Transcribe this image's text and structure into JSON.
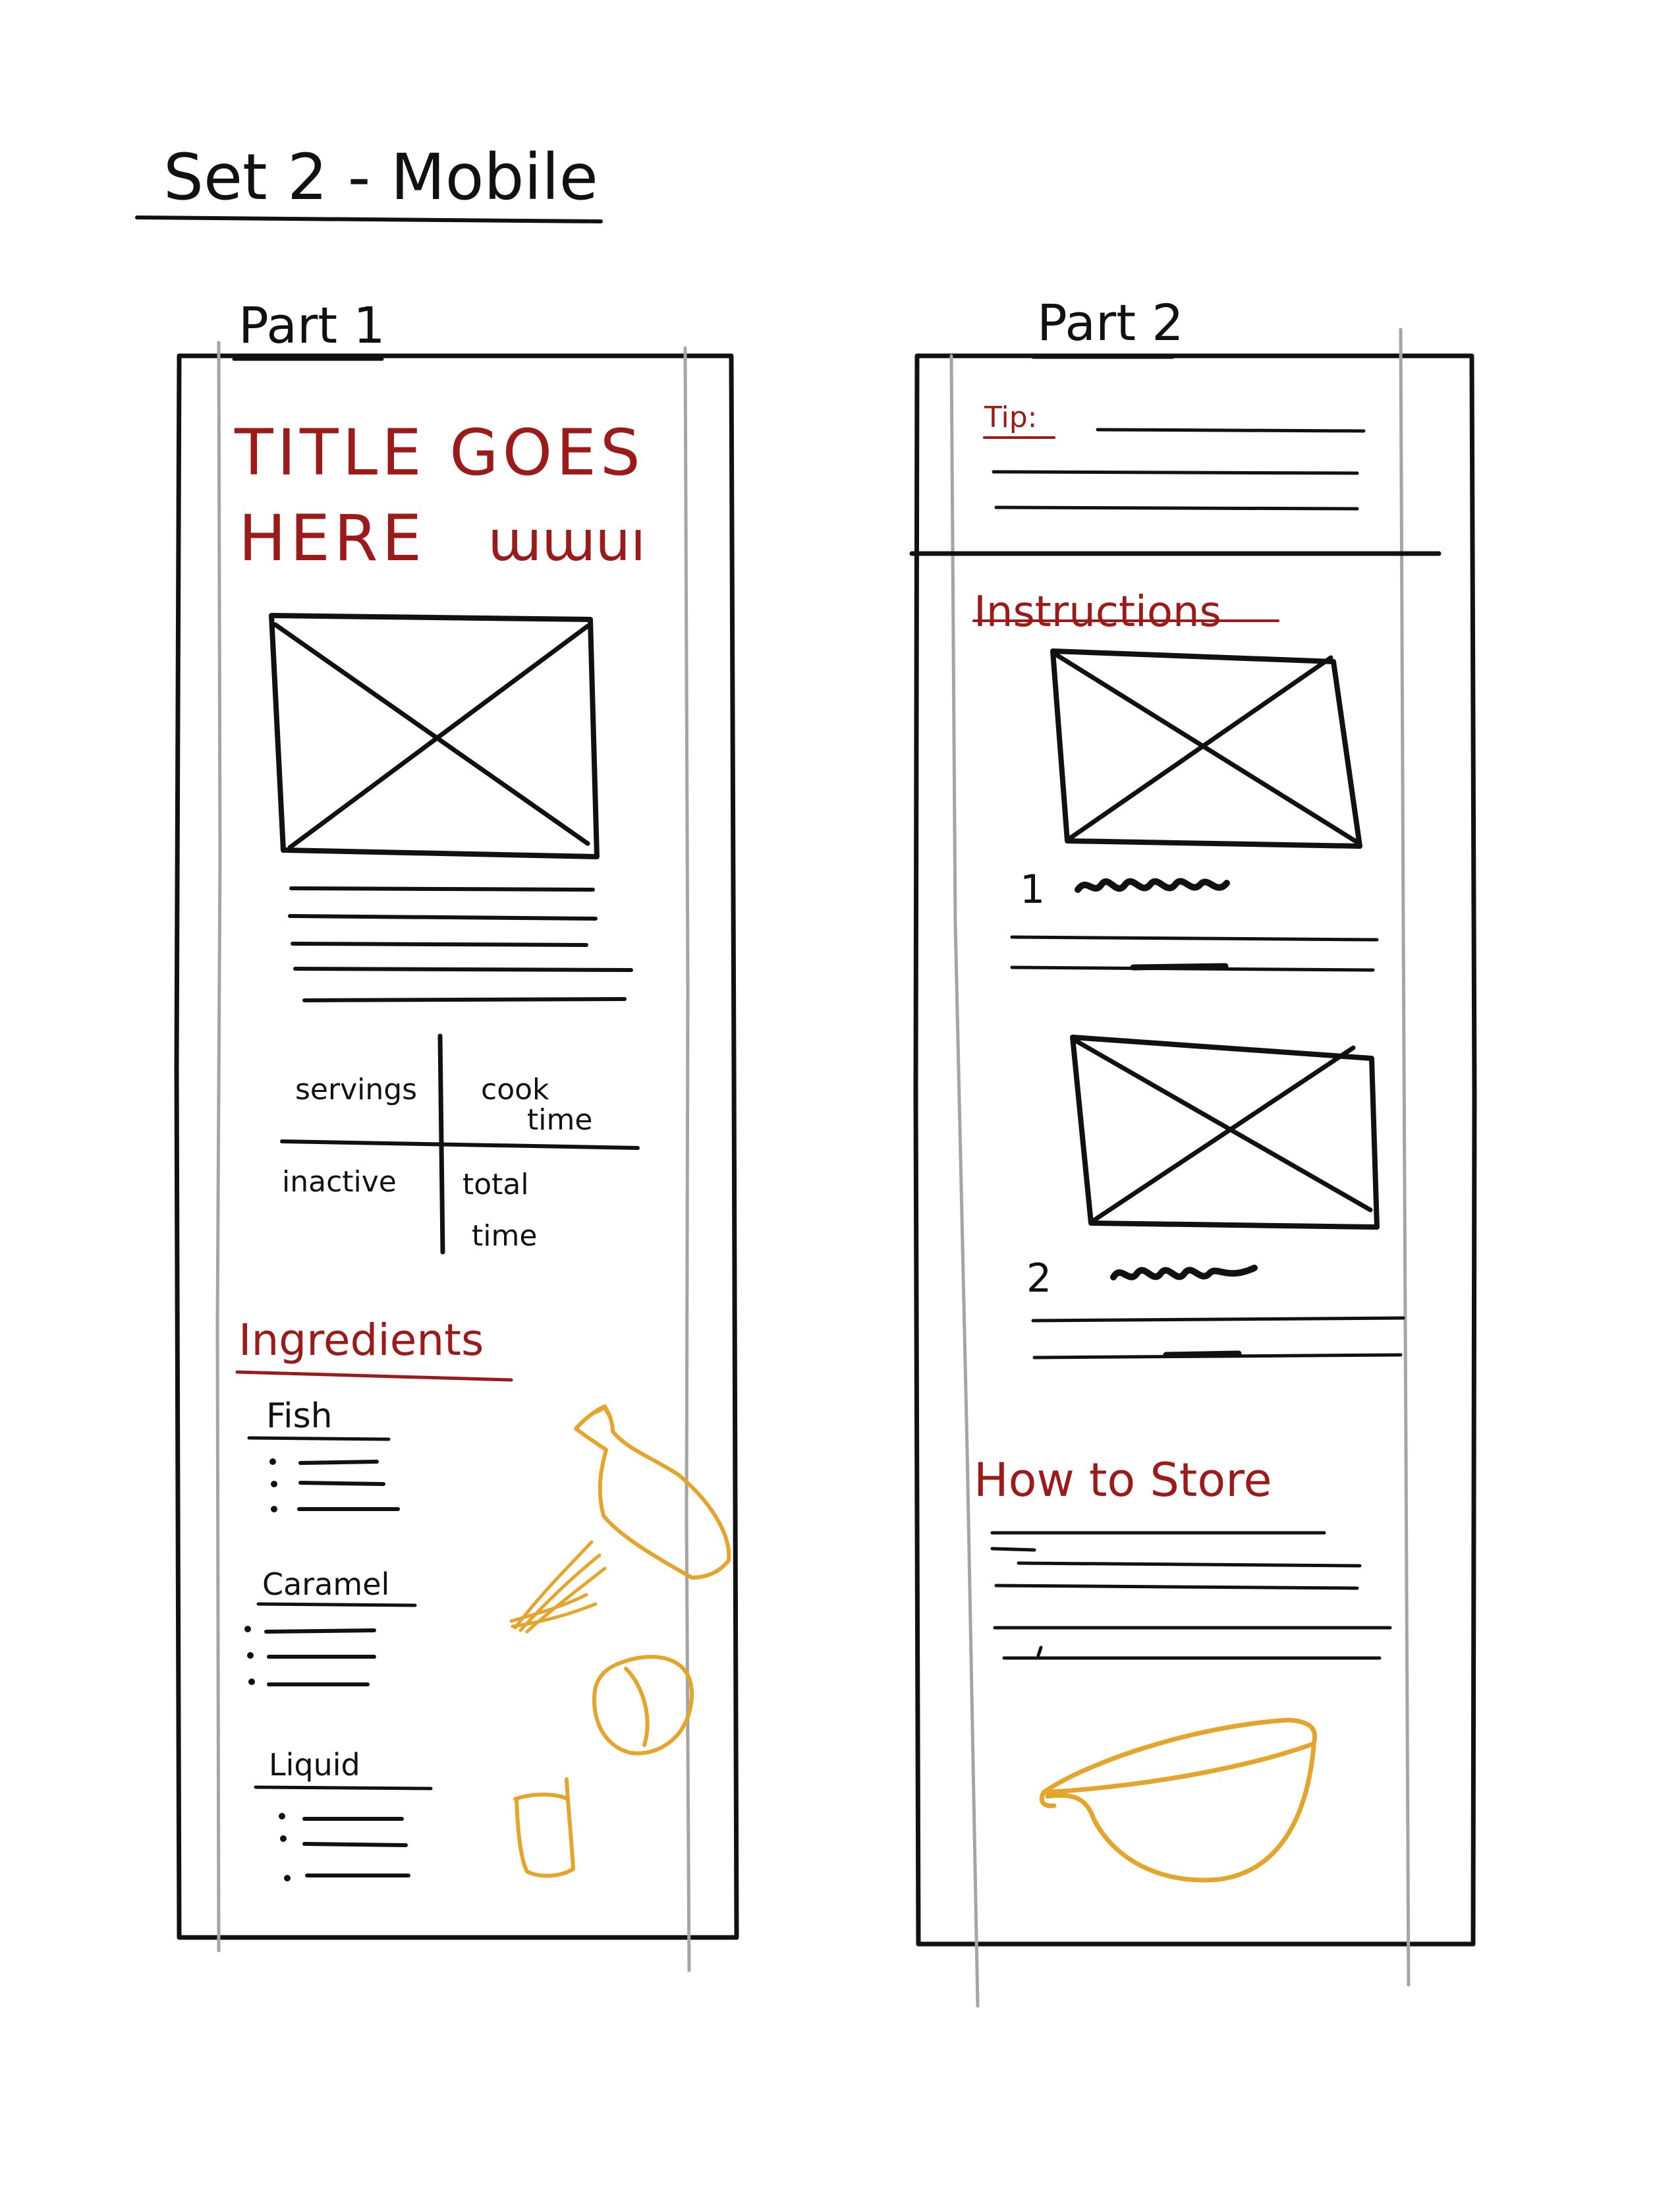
{
  "page_title": "Set 2 - Mobile",
  "colors": {
    "ink": "#111111",
    "accent_red": "#9b1b1b",
    "guide_gray": "#a5a5a5",
    "doodle_orange": "#e3a52c"
  },
  "part1": {
    "label": "Part 1",
    "title_line1": "TITLE GOES",
    "title_line2": "HERE",
    "title_scribble": "ɯɯuı",
    "image_placeholder_icon": "crossed-box-image-icon",
    "stats": {
      "servings": "servings",
      "cook_time_line1": "cook",
      "cook_time_line2": "time",
      "inactive": "inactive",
      "total_time_line1": "total",
      "total_time_line2": "time"
    },
    "ingredients_heading": "Ingredients",
    "groups": [
      "Fish",
      "Caramel",
      "Liquid"
    ],
    "doodles": [
      "bottle-icon",
      "lemongrass-icon",
      "onion-icon",
      "cup-icon"
    ]
  },
  "part2": {
    "label": "Part 2",
    "tip_label": "Tip:",
    "instructions_heading": "Instructions",
    "step_numbers": [
      "1",
      "2"
    ],
    "store_heading": "How to Store",
    "doodles": [
      "bowl-icon"
    ]
  }
}
